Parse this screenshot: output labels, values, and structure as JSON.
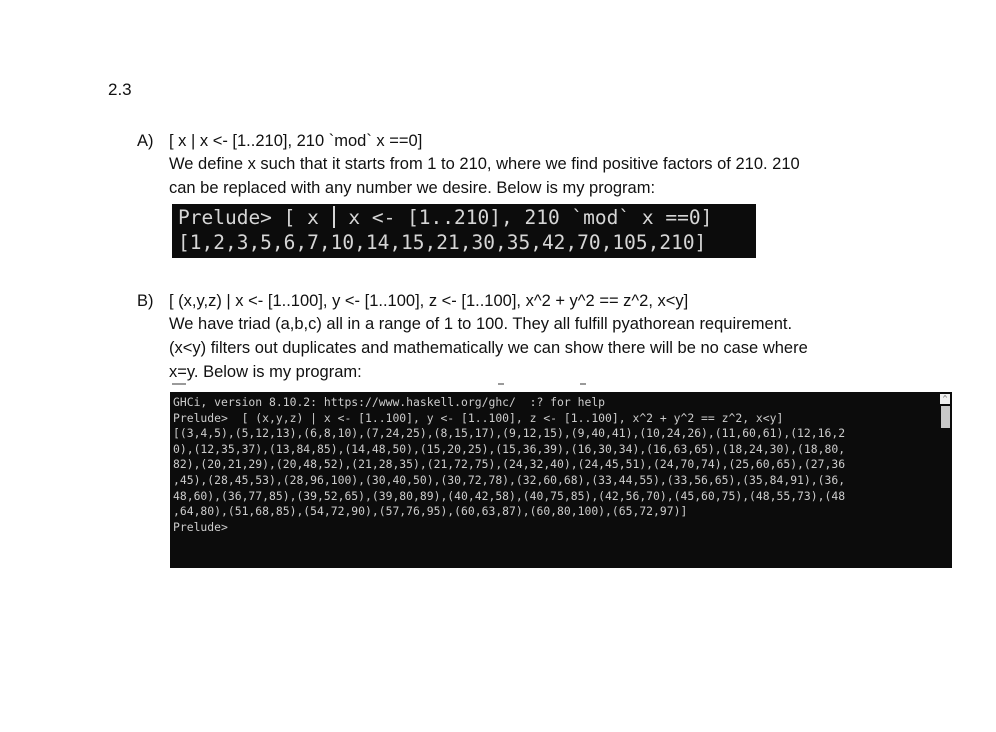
{
  "section": "2.3",
  "item_a": {
    "letter": "A)",
    "expression": "[ x | x <- [1..210], 210 `mod` x ==0]",
    "desc": [
      "We define x such that it starts from 1 to 210, where we find positive factors of 210. 210",
      "can be replaced with any number we desire. Below is my program:"
    ],
    "terminal": {
      "prompt": "Prelude>",
      "cmd_before_bar": " [ x ",
      "cmd_after_bar": " x <- [1..210], 210 `mod` x ==0]",
      "output": "[1,2,3,5,6,7,10,14,15,21,30,35,42,70,105,210]"
    }
  },
  "item_b": {
    "letter": "B)",
    "expression": "[ (x,y,z) | x <- [1..100], y <- [1..100], z <- [1..100], x^2 + y^2 == z^2, x<y]",
    "desc": [
      "We have triad (a,b,c) all in a range of 1 to 100. They all fulfill pyathorean requirement.",
      "(x<y) filters out duplicates and mathematically we can show there will be no case where",
      "x=y. Below is my program:"
    ],
    "terminal": {
      "lines": [
        "GHCi, version 8.10.2: https://www.haskell.org/ghc/  :? for help",
        "Prelude>  [ (x,y,z) | x <- [1..100], y <- [1..100], z <- [1..100], x^2 + y^2 == z^2, x<y]",
        "[(3,4,5),(5,12,13),(6,8,10),(7,24,25),(8,15,17),(9,12,15),(9,40,41),(10,24,26),(11,60,61),(12,16,2",
        "0),(12,35,37),(13,84,85),(14,48,50),(15,20,25),(15,36,39),(16,30,34),(16,63,65),(18,24,30),(18,80,",
        "82),(20,21,29),(20,48,52),(21,28,35),(21,72,75),(24,32,40),(24,45,51),(24,70,74),(25,60,65),(27,36",
        ",45),(28,45,53),(28,96,100),(30,40,50),(30,72,78),(32,60,68),(33,44,55),(33,56,65),(35,84,91),(36,",
        "48,60),(36,77,85),(39,52,65),(39,80,89),(40,42,58),(40,75,85),(42,56,70),(45,60,75),(48,55,73),(48",
        ",64,80),(51,68,85),(54,72,90),(57,76,95),(60,63,87),(60,80,100),(65,72,97)]",
        "Prelude>"
      ],
      "scroll_up_glyph": "^"
    }
  }
}
